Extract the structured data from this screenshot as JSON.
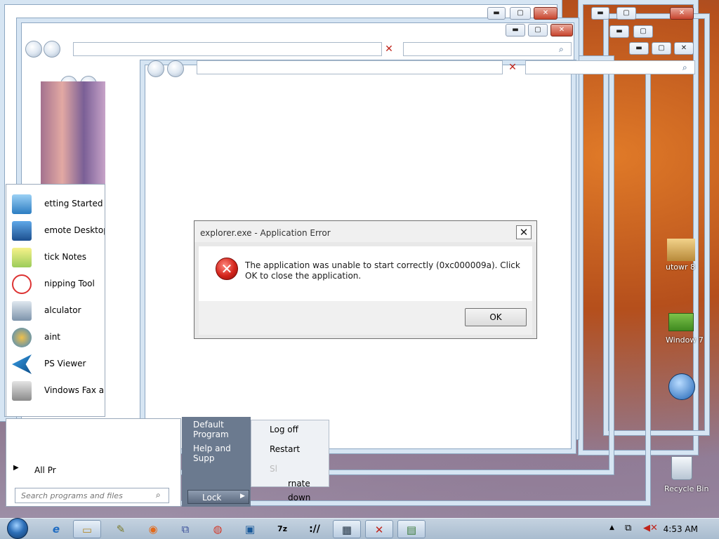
{
  "dialog": {
    "title": "explorer.exe - Application Error",
    "message": "The application was unable to start correctly (0xc000009a). Click OK to close the application.",
    "ok_label": "OK",
    "close_glyph": "✕",
    "icon": "error-icon"
  },
  "start_menu": {
    "items": [
      {
        "label": "etting Started",
        "icon": "getting-started-icon"
      },
      {
        "label": "emote Desktop C",
        "icon": "remote-desktop-icon"
      },
      {
        "label": "tick  Notes",
        "icon": "sticky-notes-icon"
      },
      {
        "label": "nipping Tool",
        "icon": "snipping-tool-icon"
      },
      {
        "label": "alculator",
        "icon": "calculator-icon"
      },
      {
        "label": "aint",
        "icon": "paint-icon"
      },
      {
        "label": "PS Viewer",
        "icon": "xps-viewer-icon"
      },
      {
        "label": "Vindows Fax and S",
        "icon": "fax-icon"
      }
    ],
    "all_programs": "All Pr",
    "search_placeholder": "Search programs and files",
    "right_items": [
      "Default Program",
      "Help and Supp"
    ],
    "power_items": [
      "Log off",
      "Restart",
      "Sl",
      "rnate",
      "down"
    ],
    "lock_label": "Lock"
  },
  "desktop_icons": [
    {
      "label": "utowr 8",
      "icon": "folder-icon"
    },
    {
      "label": "Window 7",
      "icon": "windows-icon"
    },
    {
      "label": "Recycle Bin",
      "icon": "recycle-bin-icon"
    }
  ],
  "taskbar": {
    "clock": "4:53 AM",
    "buttons": [
      {
        "name": "ie-icon",
        "glyph": "e"
      },
      {
        "name": "explorer-icon",
        "glyph": "▭"
      },
      {
        "name": "notepad-icon",
        "glyph": "✎"
      },
      {
        "name": "firefox-icon",
        "glyph": "◉"
      },
      {
        "name": "network-icon",
        "glyph": "⧉"
      },
      {
        "name": "chrome-icon",
        "glyph": "◍"
      },
      {
        "name": "remote-desktop-icon",
        "glyph": "▣"
      },
      {
        "name": "7zip-icon",
        "glyph": "7z"
      },
      {
        "name": "terminal-icon",
        "glyph": "://"
      },
      {
        "name": "window-switcher-icon",
        "glyph": "▦"
      },
      {
        "name": "error-app-icon",
        "glyph": "✕"
      },
      {
        "name": "app-icon",
        "glyph": "▤"
      }
    ]
  },
  "colors": {
    "accent": "#2d6fb8",
    "error": "#d3241b",
    "glass": "#d6e5f3"
  }
}
